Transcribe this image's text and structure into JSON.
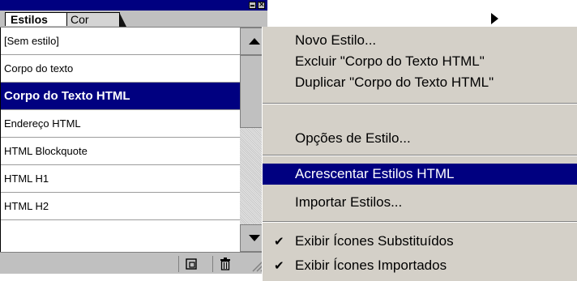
{
  "palette": {
    "tabs": [
      {
        "label": "Estilos"
      },
      {
        "label": "Cor"
      }
    ],
    "list_items": [
      {
        "label": "[Sem estilo]"
      },
      {
        "label": "Corpo do texto"
      },
      {
        "label": "Corpo do Texto HTML",
        "selected": true
      },
      {
        "label": "Endereço HTML"
      },
      {
        "label": "HTML Blockquote"
      },
      {
        "label": "HTML H1"
      },
      {
        "label": "HTML H2"
      }
    ],
    "icons": {
      "minimize": "minimize-icon",
      "close": "close-icon",
      "menu": "palette-menu-arrow-icon",
      "new_style": "new-style-icon",
      "delete": "trash-icon",
      "resize": "resize-grip-icon"
    },
    "colors": {
      "selection": "#000080",
      "face": "#c0c0c0"
    }
  },
  "menu": {
    "items": [
      {
        "label": "Novo Estilo..."
      },
      {
        "label": "Excluir \"Corpo do Texto HTML\""
      },
      {
        "label": "Duplicar \"Corpo do Texto HTML\""
      },
      {
        "label": "Opções de Estilo..."
      },
      {
        "label": "Acrescentar Estilos HTML",
        "highlighted": true
      },
      {
        "label": "Importar Estilos..."
      },
      {
        "label": "Exibir Ícones Substituídos",
        "checked": true
      },
      {
        "label": "Exibir Ícones Importados",
        "checked": true
      }
    ],
    "check_glyph": "✔"
  }
}
